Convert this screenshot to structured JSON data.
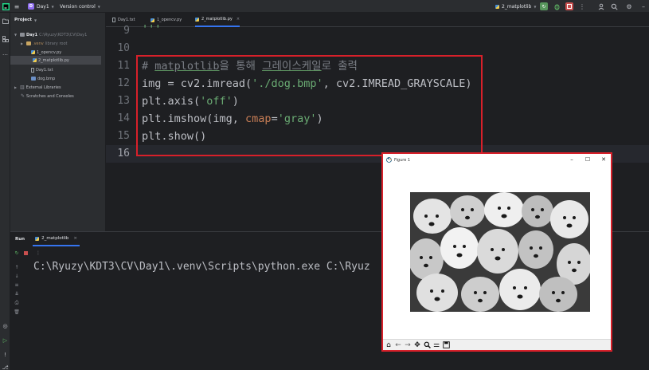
{
  "titlebar": {
    "project_badge": "D",
    "project_name": "Day1",
    "vcs_label": "Version control",
    "run_config": "2_matplotlib"
  },
  "project_panel": {
    "title": "Project",
    "items": [
      {
        "label": "Day1",
        "suffix": "C:\\Ryuzy\\KDT3\\CV\\Day1"
      },
      {
        "label": ".venv",
        "suffix": "library root"
      },
      {
        "label": "1_opencv.py"
      },
      {
        "label": "2_matplotlib.py"
      },
      {
        "label": "Day1.txt"
      },
      {
        "label": "dog.bmp"
      },
      {
        "label": "External Libraries"
      },
      {
        "label": "Scratches and Consoles"
      }
    ]
  },
  "tabs": [
    {
      "label": "Day1.txt"
    },
    {
      "label": "1_opencv.py"
    },
    {
      "label": "2_matplotlib.py"
    }
  ],
  "editor": {
    "line_numbers": [
      "9",
      "10",
      "11",
      "12",
      "13",
      "14",
      "15",
      "16"
    ],
    "code": {
      "l9": "'''",
      "l11_hash": "# ",
      "l11_word": "matplotlib",
      "l11_p1": "을 통해 ",
      "l11_word2": "그레이스케일",
      "l11_p2": "로 출력",
      "l12_a": "img = cv2.imread(",
      "l12_str": "'./dog.bmp'",
      "l12_b": ", cv2.IMREAD_GRAYSCALE)",
      "l13_a": "plt.axis(",
      "l13_str": "'off'",
      "l13_b": ")",
      "l14_a": "plt.imshow(img, ",
      "l14_kw": "cmap",
      "l14_eq": "=",
      "l14_str": "'gray'",
      "l14_b": ")",
      "l15": "plt.show()"
    }
  },
  "run_panel": {
    "title": "Run",
    "tab_label": "2_matplotlib",
    "console_line": "C:\\Ryuzy\\KDT3\\CV\\Day1\\.venv\\Scripts\\python.exe C:\\Ryuz"
  },
  "figure": {
    "title": "Figure 1"
  }
}
